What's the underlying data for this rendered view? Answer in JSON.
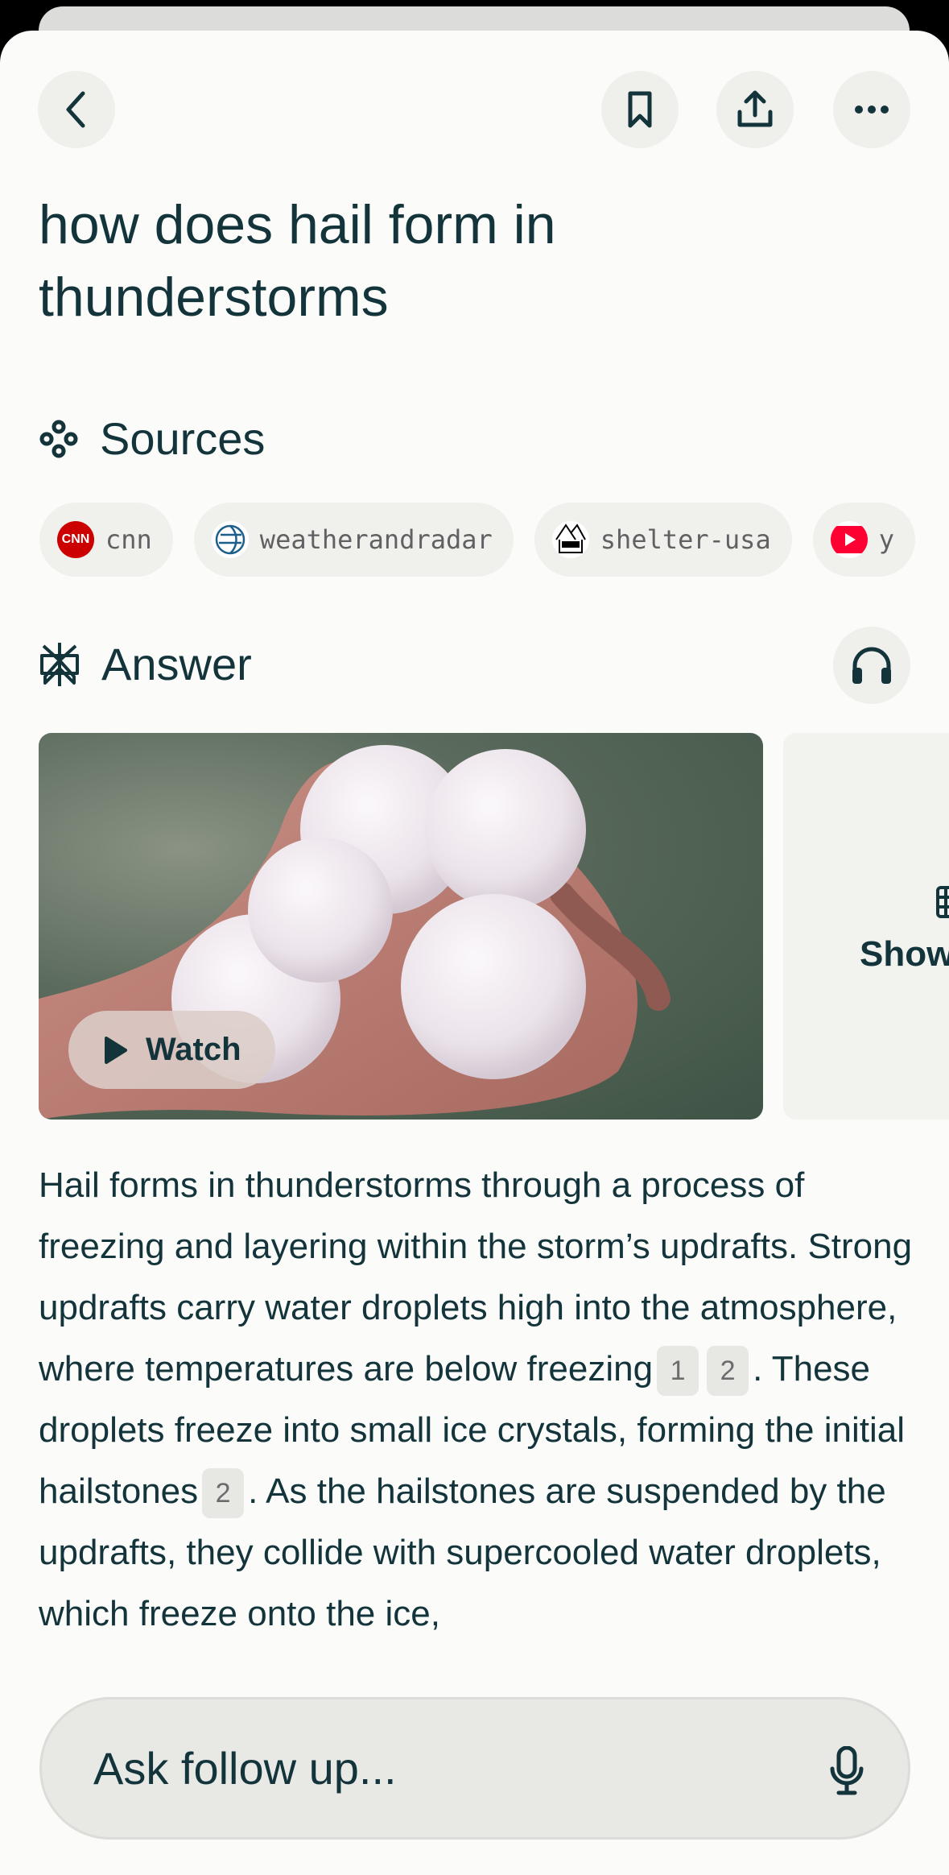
{
  "header": {
    "back": "back",
    "bookmark": "bookmark",
    "share": "share",
    "more": "more"
  },
  "query": "how does hail form in thunderstorms",
  "sources": {
    "heading": "Sources",
    "items": [
      {
        "label": "cnn",
        "icon": "cnn-logo",
        "color": "#cc0000"
      },
      {
        "label": "weatherandradar",
        "icon": "globe-logo",
        "color": "#1c5f8a"
      },
      {
        "label": "shelter-usa",
        "icon": "shelter-logo",
        "color": "#000000"
      },
      {
        "label": "y",
        "icon": "youtube-logo",
        "color": "#ff0033"
      }
    ]
  },
  "answer": {
    "heading": "Answer",
    "media": {
      "watch_label": "Watch",
      "second_card_label": "Show"
    },
    "segments": [
      {
        "t": "Hail forms in thunderstorms through a process of freezing and layering within the storm’s updrafts. Strong updrafts carry water droplets high into the atmosphere, where temperatures are below freezing"
      },
      {
        "c": "1"
      },
      {
        "c": "2"
      },
      {
        "t": ". These droplets freeze into small ice crystals, forming the initial hailstones"
      },
      {
        "c": "2"
      },
      {
        "t": ". As the hailstones are suspended by the updrafts, they collide with supercooled water droplets, which freeze onto the ice,"
      }
    ]
  },
  "followup": {
    "placeholder": "Ask follow up..."
  },
  "colors": {
    "text": "#13343b",
    "background": "#fbfbf9",
    "chip": "#f0f0ed"
  }
}
